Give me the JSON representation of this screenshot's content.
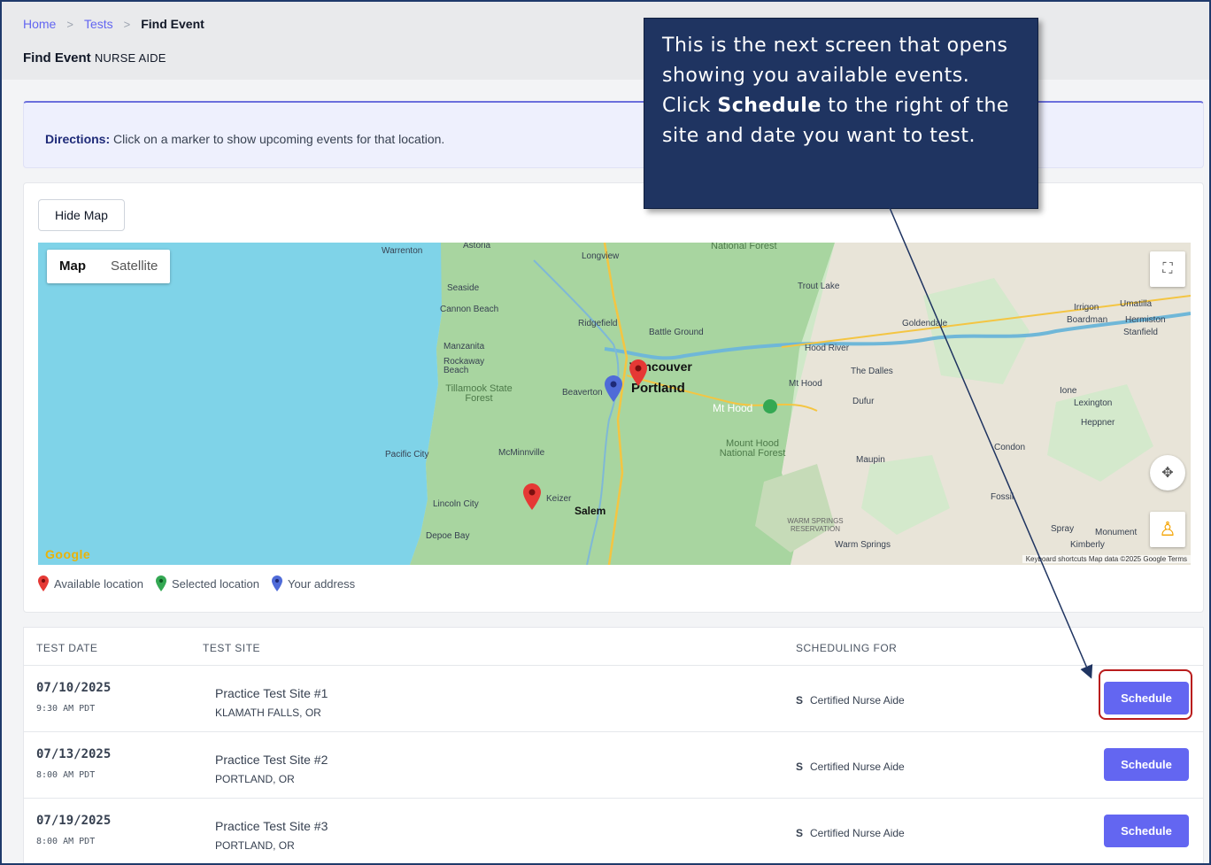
{
  "breadcrumb": {
    "home": "Home",
    "tests": "Tests",
    "current": "Find Event",
    "separator": ">"
  },
  "page": {
    "title": "Find Event",
    "subtitle": "NURSE AIDE"
  },
  "directions": {
    "label": "Directions:",
    "text": " Click on a marker to show upcoming events for that location."
  },
  "map_card": {
    "hide_map_label": "Hide Map"
  },
  "map": {
    "type_map": "Map",
    "type_satellite": "Satellite",
    "google": "Google",
    "attribution": "Keyboard shortcuts   Map data ©2025 Google   Terms",
    "cities": {
      "portland": "Portland",
      "vancouver": "Vancouver",
      "salem": "Salem",
      "mt_hood": "Mt Hood"
    },
    "places": {
      "astoria": "Astoria",
      "warrenton": "Warrenton",
      "longview": "Longview",
      "seaside": "Seaside",
      "cannon_beach": "Cannon Beach",
      "manzanita": "Manzanita",
      "rockaway": "Rockaway Beach",
      "tillamook": "Tillamook State Forest",
      "ridgefield": "Ridgefield",
      "battle_ground": "Battle Ground",
      "beaverton": "Beaverton",
      "mcminnville": "McMinnville",
      "pacific_city": "Pacific City",
      "lincoln_city": "Lincoln City",
      "depoe_bay": "Depoe Bay",
      "keizer": "Keizer",
      "trout_lake": "Trout Lake",
      "hood_river": "Hood River",
      "the_dalles": "The Dalles",
      "mt_hood_town": "Mt Hood",
      "dufur": "Dufur",
      "mount_hood_nf": "Mount Hood National Forest",
      "maupin": "Maupin",
      "warm_springs": "WARM SPRINGS RESERVATION",
      "warm_springs_town": "Warm Springs",
      "goldendale": "Goldendale",
      "national_forest": "National Forest",
      "irrigon": "Irrigon",
      "boardman": "Boardman",
      "umatilla": "Umatilla",
      "hermiston": "Hermiston",
      "stanfield": "Stanfield",
      "ione": "Ione",
      "lexington": "Lexington",
      "heppner": "Heppner",
      "condon": "Condon",
      "fossil": "Fossil",
      "spray": "Spray",
      "kimberly": "Kimberly",
      "monument": "Monument"
    }
  },
  "legend": {
    "available": "Available location",
    "selected": "Selected location",
    "your_address": "Your address",
    "colors": {
      "available": "#e53935",
      "selected": "#34a853",
      "address": "#4f6bd8"
    }
  },
  "table": {
    "headers": {
      "date": "TEST DATE",
      "site": "TEST SITE",
      "scheduling": "SCHEDULING FOR"
    },
    "rows": [
      {
        "date": "07/10/2025",
        "time": "9:30 AM PDT",
        "site": "Practice Test Site #1",
        "location": "KLAMATH FALLS, OR",
        "program_code": "S",
        "program": "Certified Nurse Aide",
        "action": "Schedule"
      },
      {
        "date": "07/13/2025",
        "time": "8:00 AM PDT",
        "site": "Practice Test Site #2",
        "location": "PORTLAND, OR",
        "program_code": "S",
        "program": "Certified Nurse Aide",
        "action": "Schedule"
      },
      {
        "date": "07/19/2025",
        "time": "8:00 AM PDT",
        "site": "Practice Test Site #3",
        "location": "PORTLAND, OR",
        "program_code": "S",
        "program": "Certified Nurse Aide",
        "action": "Schedule"
      }
    ]
  },
  "callout": {
    "text_before": "This is the next screen that opens showing you available events.  Click ",
    "bold": "Schedule",
    "text_after": " to the right of the site and date you want to test."
  },
  "colors": {
    "accent": "#6366f1",
    "callout_bg": "#1f3461",
    "highlight": "#b91c1c"
  }
}
